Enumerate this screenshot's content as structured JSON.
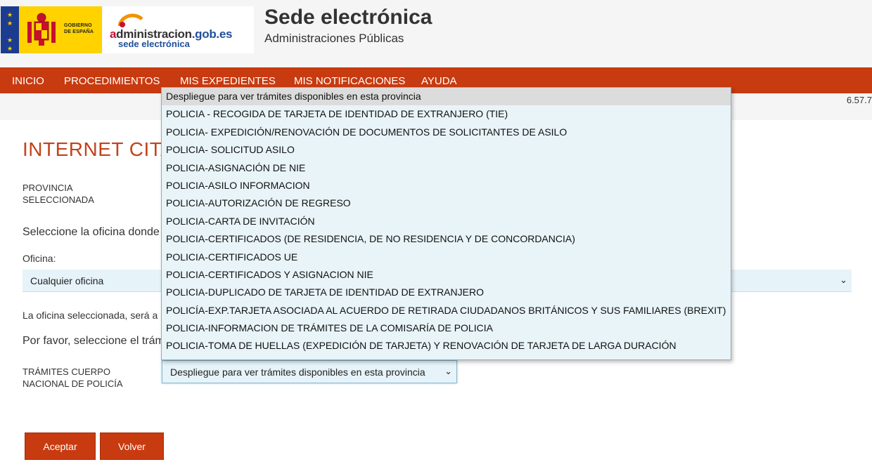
{
  "header": {
    "gov_text": [
      "GOBIERNO",
      "DE ESPAÑA"
    ],
    "admin_logo_main_a": "a",
    "admin_logo_main_rest": "dministracion",
    "admin_logo_main_gob": ".gob.es",
    "admin_logo_sub": "sede electrónica",
    "title": "Sede electrónica",
    "subtitle": "Administraciones Públicas"
  },
  "nav": {
    "items": [
      "INICIO",
      "PROCEDIMIENTOS",
      "MIS EXPEDIENTES",
      "MIS NOTIFICACIONES",
      "AYUDA"
    ]
  },
  "version": "6.57.7",
  "main": {
    "title": "INTERNET CITA",
    "provincia_label": [
      "PROVINCIA",
      "SELECCIONADA"
    ],
    "select_office_text": "Seleccione la oficina donde",
    "oficina_label": "Oficina:",
    "oficina_value": "Cualquier oficina",
    "oficina_note": "La oficina seleccionada, será a",
    "porfavor_text": "Por favor, seleccione el trám",
    "tramites_label": [
      "TRÁMITES CUERPO",
      "NACIONAL DE POLICÍA"
    ],
    "tramites_value": "Despliegue para ver trámites disponibles en esta provincia",
    "accept_label": "Aceptar",
    "back_label": "Volver"
  },
  "dropdown": {
    "options": [
      "Despliegue para ver trámites disponibles en esta provincia",
      "POLICIA - RECOGIDA DE TARJETA DE IDENTIDAD DE EXTRANJERO (TIE)",
      "POLICIA- EXPEDICIÓN/RENOVACIÓN DE DOCUMENTOS DE SOLICITANTES DE ASILO",
      "POLICIA- SOLICITUD ASILO",
      "POLICIA-ASIGNACIÓN DE NIE",
      "POLICIA-ASILO INFORMACION",
      "POLICIA-AUTORIZACIÓN DE REGRESO",
      "POLICIA-CARTA DE INVITACIÓN",
      "POLICIA-CERTIFICADOS (DE RESIDENCIA, DE NO RESIDENCIA Y DE CONCORDANCIA)",
      "POLICIA-CERTIFICADOS UE",
      "POLICIA-CERTIFICADOS Y ASIGNACION NIE",
      "POLICIA-DUPLICADO DE TARJETA DE IDENTIDAD DE EXTRANJERO",
      "POLICÍA-EXP.TARJETA ASOCIADA AL ACUERDO DE RETIRADA CIUDADANOS BRITÁNICOS Y SUS FAMILIARES (BREXIT)",
      "POLICIA-INFORMACION DE TRÁMITES DE LA COMISARÍA DE POLICIA",
      "POLICIA-TOMA DE HUELLAS (EXPEDICIÓN DE TARJETA) Y RENOVACIÓN DE TARJETA DE LARGA DURACIÓN"
    ],
    "selected_index": 0
  },
  "colors": {
    "brand_red": "#c83a0f",
    "title_red": "#c0441c",
    "select_bg": "#e6f3f8"
  }
}
